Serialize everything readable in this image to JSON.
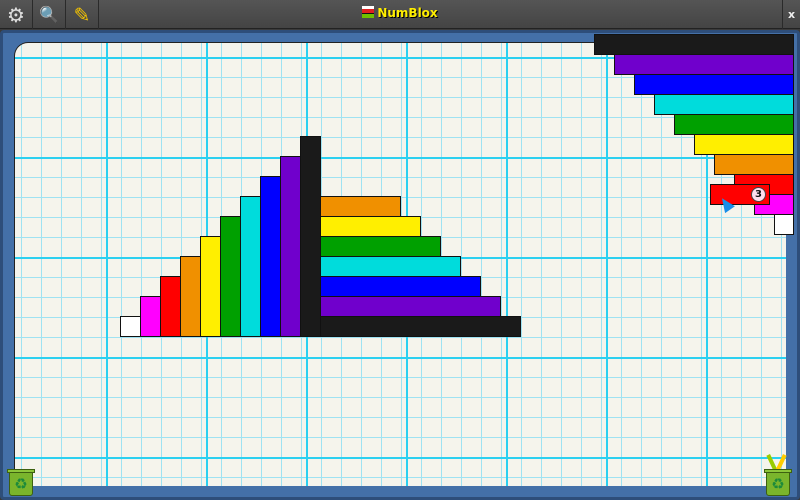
{
  "app": {
    "title": "NumBlox",
    "close_label": "x"
  },
  "toolbar": [
    {
      "name": "settings",
      "icon": "gear-icon",
      "glyph": "⚙"
    },
    {
      "name": "zoom",
      "icon": "zoom-in-icon",
      "glyph": "🔍"
    },
    {
      "name": "pencil",
      "icon": "pencil-icon",
      "glyph": "✎"
    }
  ],
  "colors": {
    "1": "#ffffff",
    "2": "#ff00ff",
    "3": "#ff0000",
    "4": "#f09000",
    "5": "#ffef00",
    "6": "#00a000",
    "7": "#00dcdc",
    "8": "#0000ff",
    "9": "#7000cc",
    "10": "#1a1a1a"
  },
  "staircase_vertical": [
    1,
    2,
    3,
    4,
    5,
    6,
    7,
    8,
    9,
    10
  ],
  "staircase_horizontal": [
    4,
    5,
    6,
    7,
    8,
    9,
    10
  ],
  "tray_blocks": [
    10,
    9,
    8,
    7,
    6,
    5,
    4,
    3,
    2,
    1
  ],
  "dragged_block": {
    "value": 3,
    "badge": "3"
  },
  "bins": {
    "left": "recycle-bin",
    "right": "recycle-bin-with-pencils"
  }
}
